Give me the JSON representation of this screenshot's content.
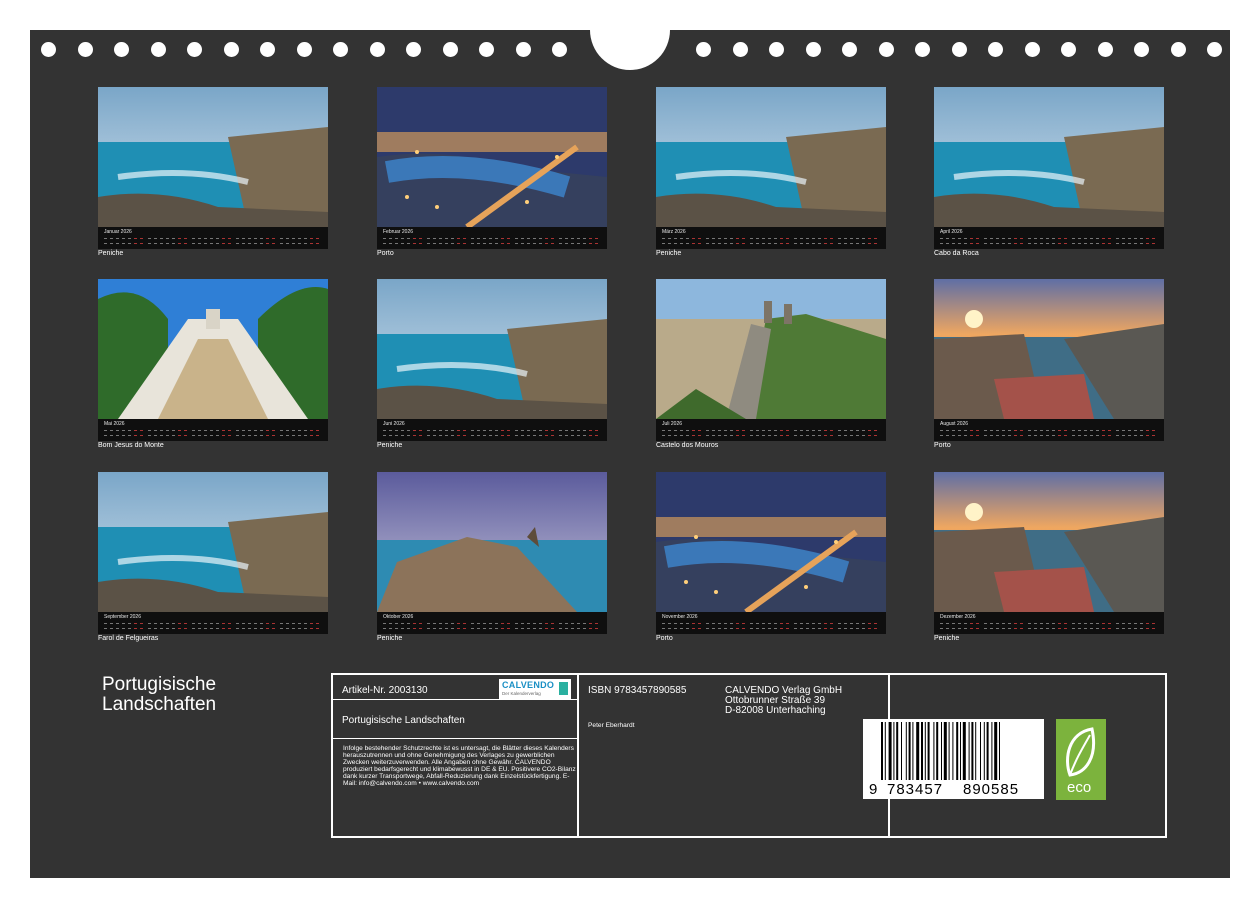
{
  "title": [
    "Portugisische",
    "Landschaften"
  ],
  "months": [
    {
      "month": "Januar 2026",
      "place": "Peniche",
      "scene": "coast"
    },
    {
      "month": "Februar 2026",
      "place": "Porto",
      "scene": "night"
    },
    {
      "month": "März 2026",
      "place": "Peniche",
      "scene": "coast"
    },
    {
      "month": "April 2026",
      "place": "Cabo da Roca",
      "scene": "coast"
    },
    {
      "month": "Mai 2026",
      "place": "Bom Jesus do Monte",
      "scene": "stairs"
    },
    {
      "month": "Juni 2026",
      "place": "Peniche",
      "scene": "coast"
    },
    {
      "month": "Juli 2026",
      "place": "Castelo dos Mouros",
      "scene": "green"
    },
    {
      "month": "August 2026",
      "place": "Porto",
      "scene": "sunset"
    },
    {
      "month": "September 2026",
      "place": "Farol de Felgueiras",
      "scene": "coast"
    },
    {
      "month": "Oktober 2026",
      "place": "Peniche",
      "scene": "rocks"
    },
    {
      "month": "November 2026",
      "place": "Porto",
      "scene": "night"
    },
    {
      "month": "Dezember 2026",
      "place": "Peniche",
      "scene": "sunset"
    }
  ],
  "info": {
    "article": "Artikel-Nr. 2003130",
    "logo": "CALVENDO",
    "logo_sub": "Der Kalenderverlag",
    "product_title": "Portugisische Landschaften",
    "legal": "Infolge bestehender Schutzrechte ist es untersagt, die Blätter dieses Kalenders herauszutrennen und ohne Genehmigung des Verlages zu gewerblichen Zwecken weiterzuverwenden. Alle Angaben ohne Gewähr. CALVENDO produziert bedarfsgerecht und klimabewusst in DE & EU. Positivere CO2-Bilanz dank kurzer Transportwege, Abfall-Reduzierung dank Einzelstückfertigung. E-Mail: info@calvendo.com • www.calvendo.com",
    "isbn": "ISBN 9783457890585",
    "author": "Peter Eberhardt",
    "publisher": [
      "CALVENDO Verlag GmbH",
      "Ottobrunner Straße 39",
      "D-82008 Unterhaching"
    ],
    "barcode_digits": [
      "9",
      "783457",
      "890585"
    ],
    "eco_label": "eco"
  }
}
